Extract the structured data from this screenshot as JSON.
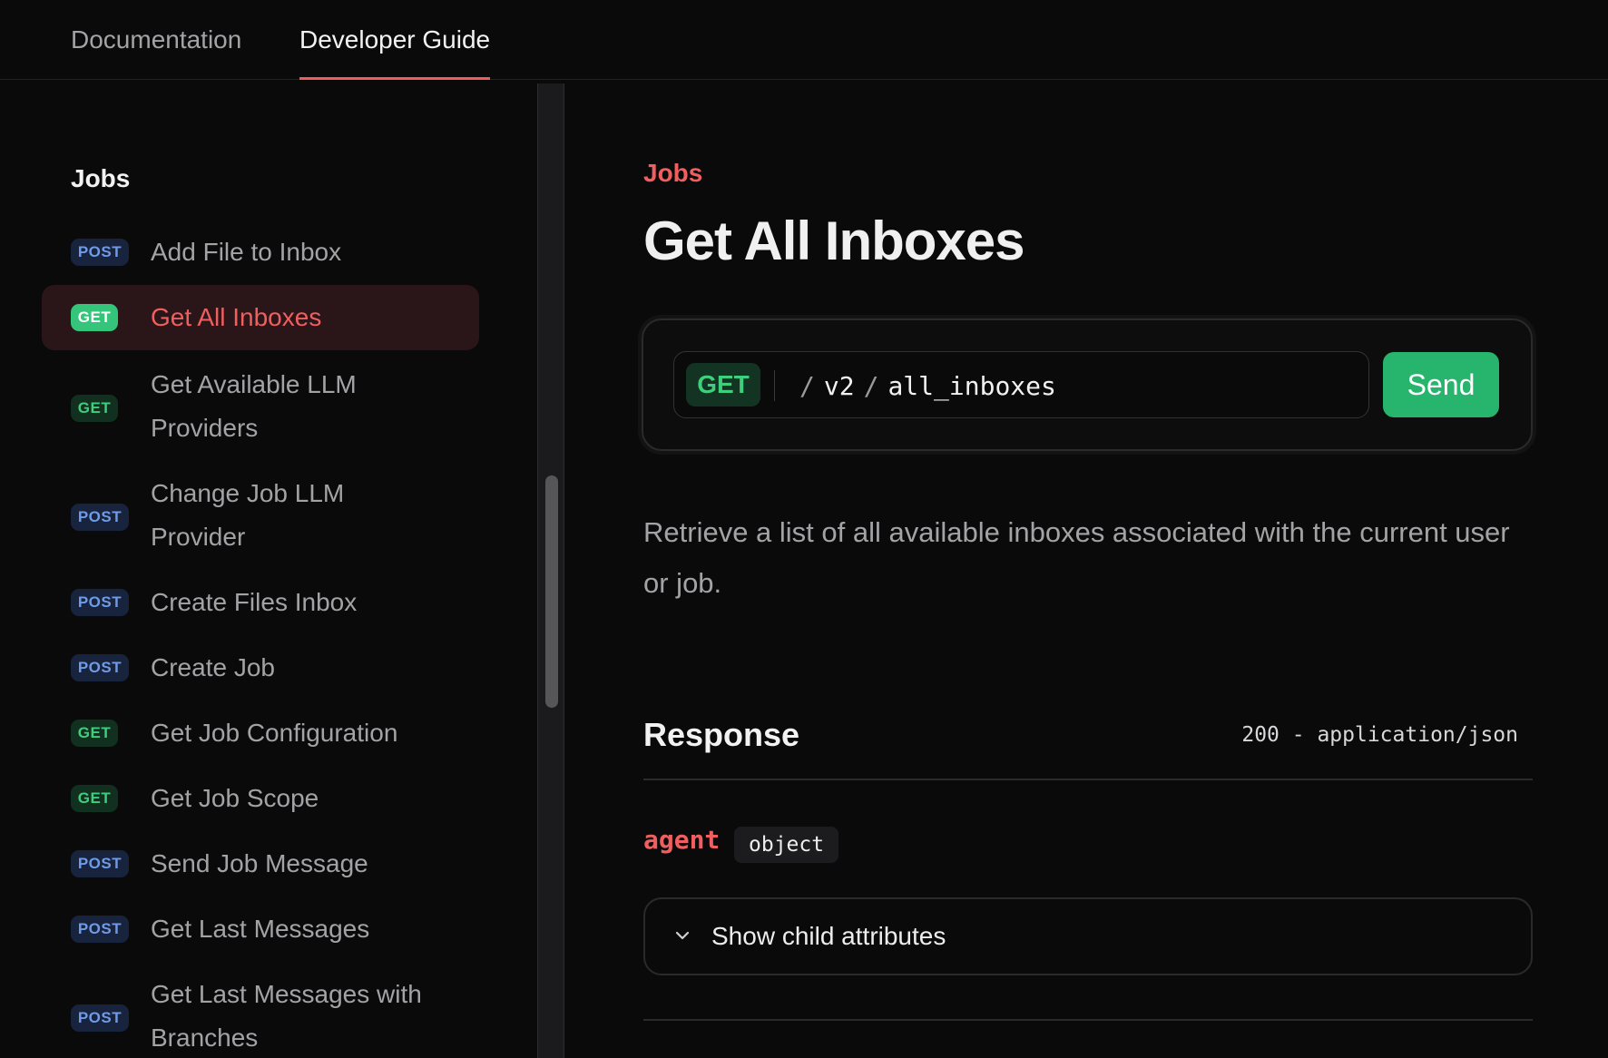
{
  "topbar": {
    "tabs": [
      {
        "label": "Documentation",
        "active": false
      },
      {
        "label": "Developer Guide",
        "active": true
      }
    ]
  },
  "sidebar": {
    "heading": "Jobs",
    "items": [
      {
        "method": "POST",
        "label": "Add File to Inbox",
        "selected": false
      },
      {
        "method": "GET",
        "label": "Get All Inboxes",
        "selected": true
      },
      {
        "method": "GET",
        "label": "Get Available LLM Providers",
        "selected": false
      },
      {
        "method": "POST",
        "label": "Change Job LLM Provider",
        "selected": false
      },
      {
        "method": "POST",
        "label": "Create Files Inbox",
        "selected": false
      },
      {
        "method": "POST",
        "label": "Create Job",
        "selected": false
      },
      {
        "method": "GET",
        "label": "Get Job Configuration",
        "selected": false
      },
      {
        "method": "GET",
        "label": "Get Job Scope",
        "selected": false
      },
      {
        "method": "POST",
        "label": "Send Job Message",
        "selected": false
      },
      {
        "method": "POST",
        "label": "Get Last Messages",
        "selected": false
      },
      {
        "method": "POST",
        "label": "Get Last Messages with Branches",
        "selected": false
      }
    ]
  },
  "main": {
    "section": "Jobs",
    "title": "Get All Inboxes",
    "request": {
      "method": "GET",
      "sep": "/",
      "path": [
        "v2",
        "all_inboxes"
      ],
      "send_label": "Send"
    },
    "description": "Retrieve a list of all available inboxes associated with the current user or job.",
    "response": {
      "title": "Response",
      "status": "200 - application/json",
      "field": {
        "name": "agent",
        "type": "object"
      },
      "toggle_label": "Show child attributes"
    }
  },
  "colors": {
    "accent": "#ef5f5f",
    "get": "#3ecf7c",
    "post": "#6f9be8",
    "send": "#27b56d"
  },
  "icons": {
    "toggle": "chevron-down-icon"
  }
}
